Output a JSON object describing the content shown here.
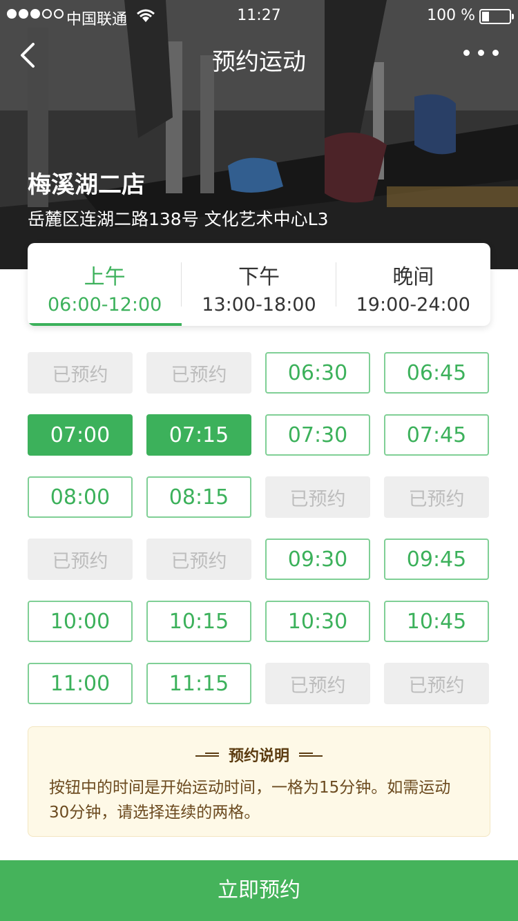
{
  "status_bar": {
    "carrier": "中国联通",
    "time": "11:27",
    "battery": "100 %",
    "battery_level_pct": 25
  },
  "nav": {
    "title": "预约运动"
  },
  "store": {
    "name": "梅溪湖二店",
    "address": "岳麓区连湖二路138号 文化艺术中心L3"
  },
  "tabs": [
    {
      "name": "上午",
      "range": "06:00-12:00",
      "active": true
    },
    {
      "name": "下午",
      "range": "13:00-18:00",
      "active": false
    },
    {
      "name": "晚间",
      "range": "19:00-24:00",
      "active": false
    }
  ],
  "slots": [
    {
      "label": "已预约",
      "state": "booked"
    },
    {
      "label": "已预约",
      "state": "booked"
    },
    {
      "label": "06:30",
      "state": "available"
    },
    {
      "label": "06:45",
      "state": "available"
    },
    {
      "label": "07:00",
      "state": "selected"
    },
    {
      "label": "07:15",
      "state": "selected"
    },
    {
      "label": "07:30",
      "state": "available"
    },
    {
      "label": "07:45",
      "state": "available"
    },
    {
      "label": "08:00",
      "state": "available"
    },
    {
      "label": "08:15",
      "state": "available"
    },
    {
      "label": "已预约",
      "state": "booked"
    },
    {
      "label": "已预约",
      "state": "booked"
    },
    {
      "label": "已预约",
      "state": "booked"
    },
    {
      "label": "已预约",
      "state": "booked"
    },
    {
      "label": "09:30",
      "state": "available"
    },
    {
      "label": "09:45",
      "state": "available"
    },
    {
      "label": "10:00",
      "state": "available"
    },
    {
      "label": "10:15",
      "state": "available"
    },
    {
      "label": "10:30",
      "state": "available"
    },
    {
      "label": "10:45",
      "state": "available"
    },
    {
      "label": "11:00",
      "state": "available"
    },
    {
      "label": "11:15",
      "state": "available"
    },
    {
      "label": "已预约",
      "state": "booked"
    },
    {
      "label": "已预约",
      "state": "booked"
    }
  ],
  "notice": {
    "title": "预约说明",
    "text": "按钮中的时间是开始运动时间，一格为15分钟。如需运动30分钟，请选择连续的两格。"
  },
  "footer": {
    "book_label": "立即预约"
  },
  "colors": {
    "accent": "#3cb15b",
    "button": "#45b35b",
    "notice_bg": "#fef9e7"
  }
}
